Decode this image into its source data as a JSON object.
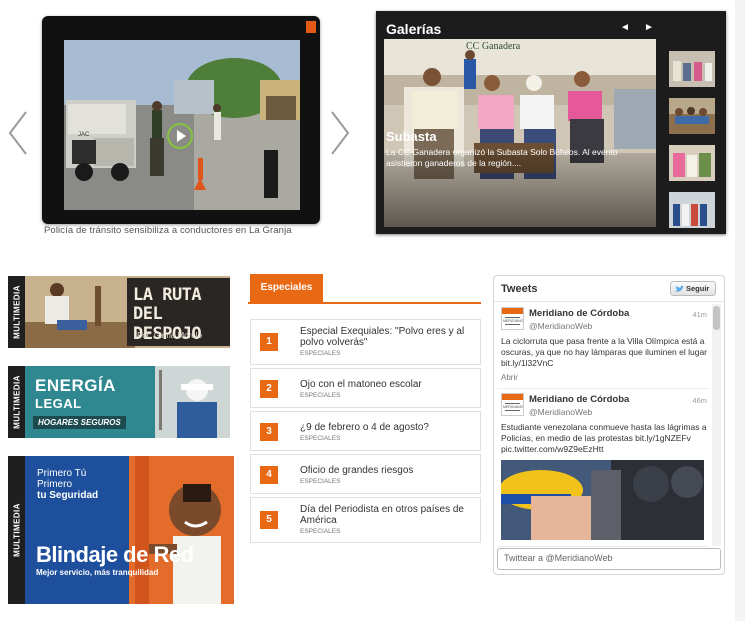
{
  "video": {
    "caption": "Policía de tránsito sensibiliza a conductores en La Granja",
    "truck_brand": "JAC",
    "colors": {
      "frame": "#111111",
      "badge": "#e25a14"
    }
  },
  "gallery": {
    "title": "Galerías",
    "prev": "◄",
    "next": "►",
    "photo_banner": "CC Ganadera",
    "heading": "Subasta",
    "text": "La CC Ganadera organizó la Subasta Solo Búfalos. Al evento asistieron ganaderos de la región....",
    "thumbs": [
      "photo-1",
      "photo-2",
      "photo-3",
      "photo-4"
    ]
  },
  "multimedia": {
    "tab_label": "MULTIMEDIA",
    "banner1": {
      "line1": "LA RUTA",
      "line2": "DEL DESPOJO",
      "byline": "Por: Ginna Morelo"
    },
    "banner2": {
      "line1": "ENERGÍA",
      "line2": "LEGAL",
      "line3": "HOGARES SEGUROS"
    },
    "banner3": {
      "line1": "Primero Tú",
      "line2": "Primero",
      "line3": "tu Seguridad",
      "title": "Blindaje de Red",
      "subtitle": "Mejor servicio, más tranquilidad"
    }
  },
  "especiales": {
    "tab": "Especiales",
    "items": [
      {
        "num": "1",
        "title": "Especial Exequiales: \"Polvo eres y al polvo volverás\"",
        "category": "ESPECIALES"
      },
      {
        "num": "2",
        "title": "Ojo con el matoneo escolar",
        "category": "ESPECIALES"
      },
      {
        "num": "3",
        "title": "¿9 de febrero o 4 de agosto?",
        "category": "ESPECIALES"
      },
      {
        "num": "4",
        "title": "Oficio de grandes riesgos",
        "category": "ESPECIALES"
      },
      {
        "num": "5",
        "title": "Día del Periodista en otros países de América",
        "category": "ESPECIALES"
      }
    ],
    "accent": "#e96813"
  },
  "tweets": {
    "title": "Tweets",
    "follow_label": "Seguir",
    "avatar_text": "MERIDIANO",
    "items": [
      {
        "name": "Meridiano de Córdoba",
        "handle": "@MeridianoWeb",
        "time": "41m",
        "text": "La ciclorruta que pasa frente a la Villa Olímpica está a oscuras, ya que no hay lámparas que iluminen el lugar bit.ly/1l32VnC",
        "action": "Abrir"
      },
      {
        "name": "Meridiano de Córdoba",
        "handle": "@MeridianoWeb",
        "time": "46m",
        "text": "Estudiante venezolana conmueve hasta las lágrimas a Policías, en medio de las protestas bit.ly/1gNZEFv pic.twitter.com/w9Z9eEzHtt"
      }
    ],
    "compose_placeholder": "Twittear a @MeridianoWeb"
  }
}
